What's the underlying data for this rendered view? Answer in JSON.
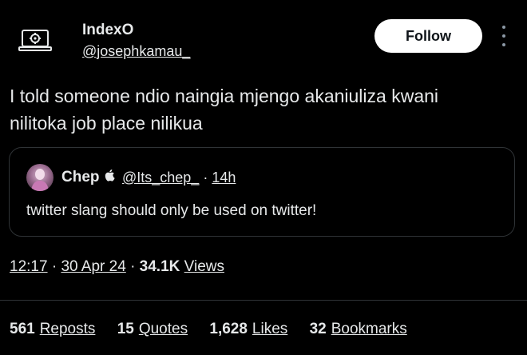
{
  "author": {
    "name": "IndexO",
    "handle": "@josephkamau_"
  },
  "follow_label": "Follow",
  "tweet": {
    "line1": "I told someone ndio naingia mjengo akaniuliza kwani",
    "line2": "nilitoka job place nilikua"
  },
  "quote": {
    "name": "Chep",
    "handle": "@Its_chep_",
    "sep": "·",
    "time": "14h",
    "text": "twitter slang should only be used on twitter!"
  },
  "meta": {
    "time": "12:17",
    "sep1": "·",
    "date": "30 Apr 24",
    "sep2": "·",
    "views_count": "34.1K",
    "views_label": "Views"
  },
  "stats": [
    {
      "count": "561",
      "label": "Reposts"
    },
    {
      "count": "15",
      "label": "Quotes"
    },
    {
      "count": "1,628",
      "label": "Likes"
    },
    {
      "count": "32",
      "label": "Bookmarks"
    }
  ],
  "icons": {
    "apple": "apple-icon",
    "more": "more-icon"
  }
}
